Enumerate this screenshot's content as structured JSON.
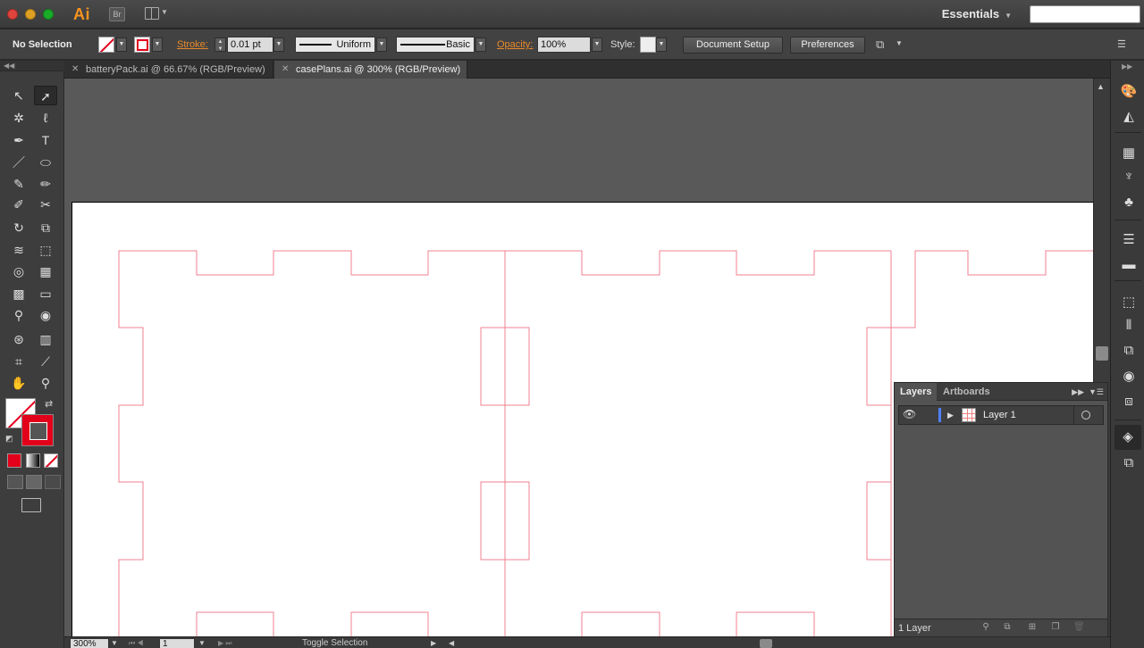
{
  "app": {
    "logo": "Ai",
    "bridge_label": "Br",
    "workspace": "Essentials"
  },
  "control": {
    "selection": "No Selection",
    "stroke_label": "Stroke:",
    "stroke_weight": "0.01 pt",
    "profile": "Uniform",
    "brush": "Basic",
    "opacity_label": "Opacity:",
    "opacity": "100%",
    "style_label": "Style:",
    "doc_setup": "Document Setup",
    "preferences": "Preferences",
    "stroke_color": "#e2001a"
  },
  "tabs": [
    {
      "label": "batteryPack.ai @ 66.67% (RGB/Preview)",
      "active": false
    },
    {
      "label": "casePlans.ai @ 300% (RGB/Preview)",
      "active": true
    }
  ],
  "tools": [
    "selection-tool",
    "direct-selection-tool",
    "magic-wand-tool",
    "lasso-tool",
    "pen-tool",
    "type-tool",
    "line-segment-tool",
    "ellipse-tool",
    "paintbrush-tool",
    "pencil-tool",
    "blob-brush-tool",
    "scissors-tool",
    "rotate-tool",
    "scale-tool",
    "warp-tool",
    "free-transform-tool",
    "shape-builder-tool",
    "graph-tool",
    "mesh-tool",
    "gradient-tool",
    "eyedropper-tool",
    "blend-tool",
    "symbol-sprayer-tool",
    "column-graph-tool",
    "artboard-tool",
    "slice-tool",
    "hand-tool",
    "zoom-tool"
  ],
  "status": {
    "zoom": "300%",
    "page": "1",
    "toggle": "Toggle Selection"
  },
  "layers_panel": {
    "tabs": [
      "Layers",
      "Artboards"
    ],
    "layers": [
      {
        "name": "Layer 1",
        "color": "#4f7fff"
      }
    ],
    "count": "1 Layer"
  },
  "dock_icons": [
    "color-icon",
    "color-guide-icon",
    "swatches-icon",
    "brushes-icon",
    "symbols-icon",
    "stroke-icon",
    "gradient-icon",
    "transform-icon",
    "align-icon",
    "pathfinder-icon",
    "appearance-icon",
    "graphic-styles-icon",
    "layers-icon",
    "artboards-icon"
  ]
}
